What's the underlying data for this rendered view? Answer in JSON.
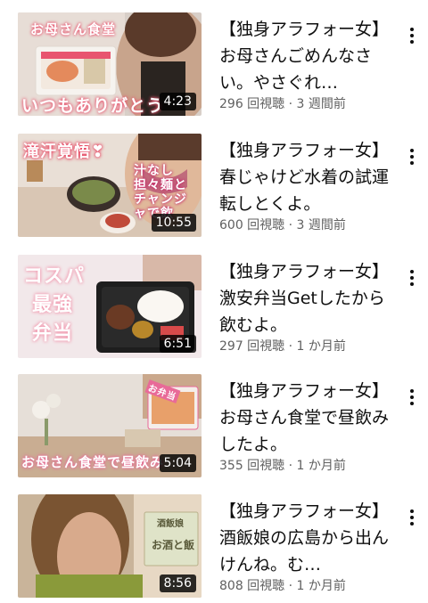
{
  "videos": [
    {
      "title": "【独身アラフォー女】お母さんごめんなさい。やさぐれ…",
      "views": "296 回視聴",
      "age": "3 週間前",
      "duration": "4:23",
      "overlay_top": "お母さん食堂",
      "overlay_bottom": "いつもありがとう",
      "colors": {
        "bg": "#d8cfc8",
        "accent": "#e8556f"
      }
    },
    {
      "title": "【独身アラフォー女】春じゃけど水着の試運転しとくよ。",
      "views": "600 回視聴",
      "age": "3 週間前",
      "duration": "10:55",
      "overlay_top": "滝汗覚悟❣",
      "overlay_bottom": "汁なし担々麺とチャンジャで飲",
      "colors": {
        "bg": "#e9dfd6",
        "accent": "#e83a5a"
      }
    },
    {
      "title": "【独身アラフォー女】激安弁当Getしたから飲むよ。",
      "views": "297 回視聴",
      "age": "1 か月前",
      "duration": "6:51",
      "overlay_top": "コスパ",
      "overlay_mid": "最強",
      "overlay_bottom": "弁当",
      "colors": {
        "bg": "#f2e8ea",
        "accent": "#f29ab0"
      }
    },
    {
      "title": "【独身アラフォー女】お母さん食堂で昼飲みしたよ。",
      "views": "355 回視聴",
      "age": "1 か月前",
      "duration": "5:04",
      "overlay_top": "お弁当",
      "overlay_bottom": "お母さん食堂で昼飲み",
      "colors": {
        "bg": "#e6dfd8",
        "accent": "#e86a98"
      }
    },
    {
      "title": "【独身アラフォー女】酒飯娘の広島から出んけんね。む…",
      "views": "808 回視聴",
      "age": "1 か月前",
      "duration": "8:56",
      "overlay_sign_top": "酒飯娘",
      "overlay_sign_bottom": "お酒と飯",
      "colors": {
        "bg": "#b49a7c",
        "accent": "#6d7b3a"
      }
    }
  ],
  "separator": " · "
}
